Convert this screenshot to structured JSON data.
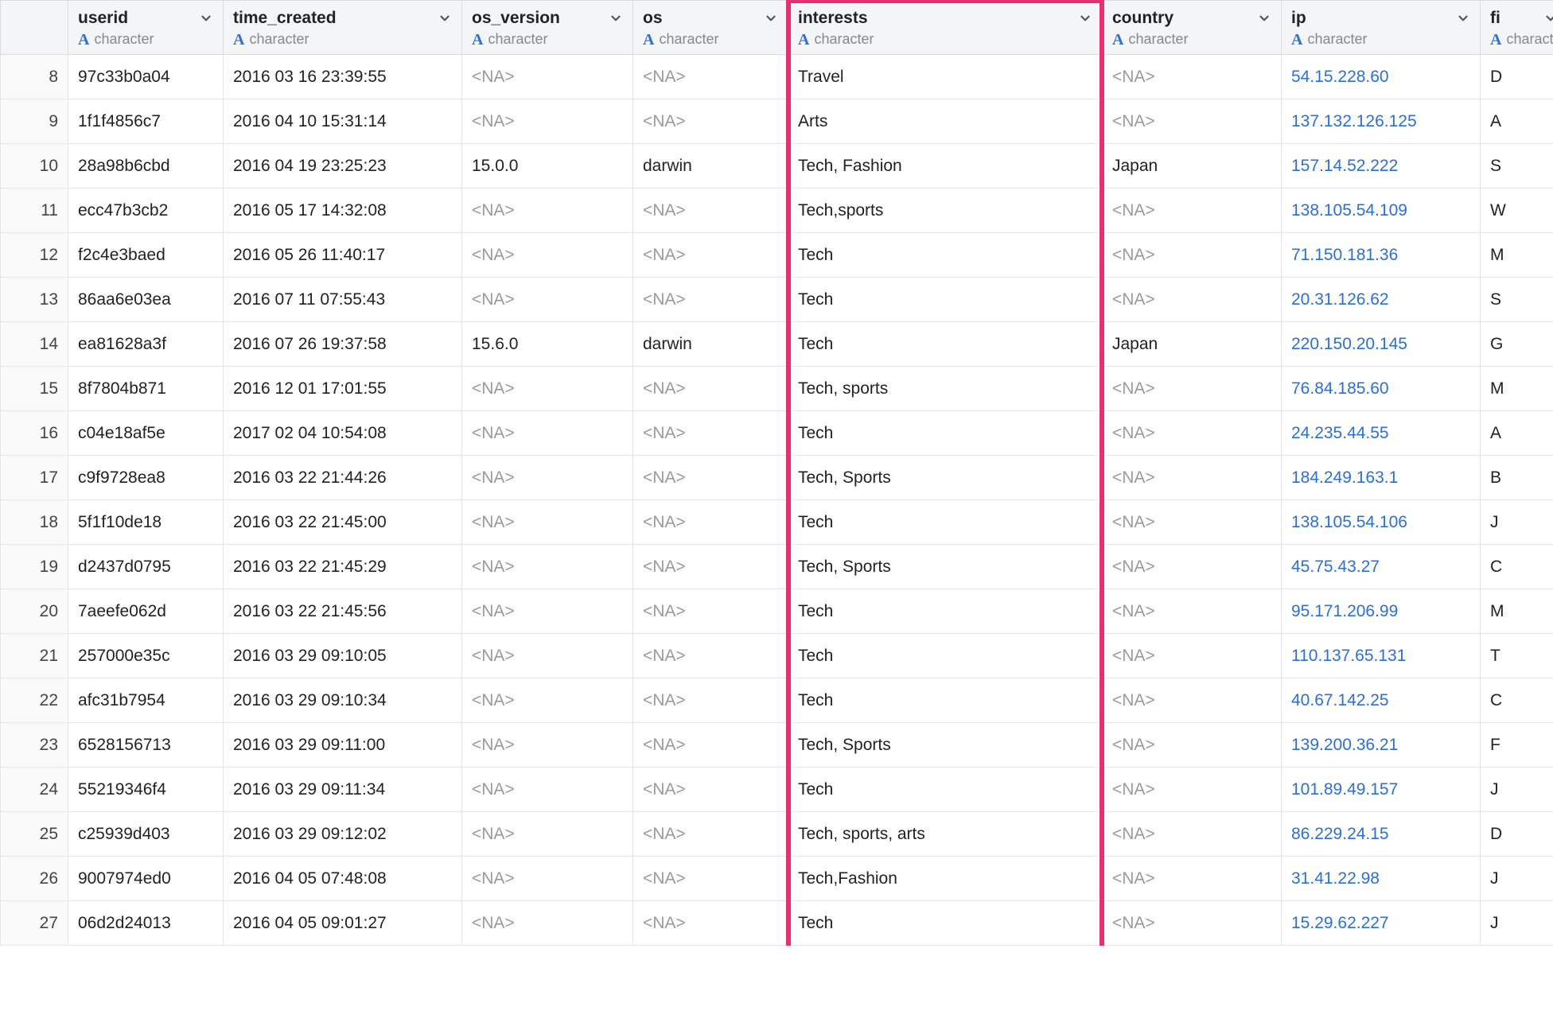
{
  "columns": [
    {
      "key": "userid",
      "label": "userid",
      "type": "character"
    },
    {
      "key": "time_created",
      "label": "time_created",
      "type": "character"
    },
    {
      "key": "os_version",
      "label": "os_version",
      "type": "character"
    },
    {
      "key": "os",
      "label": "os",
      "type": "character"
    },
    {
      "key": "interests",
      "label": "interests",
      "type": "character"
    },
    {
      "key": "country",
      "label": "country",
      "type": "character"
    },
    {
      "key": "ip",
      "label": "ip",
      "type": "character"
    },
    {
      "key": "fi",
      "label": "fi",
      "type": "character"
    }
  ],
  "na_label": "<NA>",
  "highlight_column": "interests",
  "rows": [
    {
      "n": 8,
      "userid": "97c33b0a04",
      "time_created": "2016 03 16 23:39:55",
      "os_version": null,
      "os": null,
      "interests": "Travel",
      "country": null,
      "ip": "54.15.228.60",
      "fi": "D"
    },
    {
      "n": 9,
      "userid": "1f1f4856c7",
      "time_created": "2016 04 10 15:31:14",
      "os_version": null,
      "os": null,
      "interests": "Arts",
      "country": null,
      "ip": "137.132.126.125",
      "fi": "A"
    },
    {
      "n": 10,
      "userid": "28a98b6cbd",
      "time_created": "2016 04 19 23:25:23",
      "os_version": "15.0.0",
      "os": "darwin",
      "interests": "Tech, Fashion",
      "country": "Japan",
      "ip": "157.14.52.222",
      "fi": "S"
    },
    {
      "n": 11,
      "userid": "ecc47b3cb2",
      "time_created": "2016 05 17 14:32:08",
      "os_version": null,
      "os": null,
      "interests": "Tech,sports",
      "country": null,
      "ip": "138.105.54.109",
      "fi": "W"
    },
    {
      "n": 12,
      "userid": "f2c4e3baed",
      "time_created": "2016 05 26 11:40:17",
      "os_version": null,
      "os": null,
      "interests": "Tech",
      "country": null,
      "ip": "71.150.181.36",
      "fi": "M"
    },
    {
      "n": 13,
      "userid": "86aa6e03ea",
      "time_created": "2016 07 11 07:55:43",
      "os_version": null,
      "os": null,
      "interests": "Tech",
      "country": null,
      "ip": "20.31.126.62",
      "fi": "S"
    },
    {
      "n": 14,
      "userid": "ea81628a3f",
      "time_created": "2016 07 26 19:37:58",
      "os_version": "15.6.0",
      "os": "darwin",
      "interests": "Tech",
      "country": "Japan",
      "ip": "220.150.20.145",
      "fi": "G"
    },
    {
      "n": 15,
      "userid": "8f7804b871",
      "time_created": "2016 12 01 17:01:55",
      "os_version": null,
      "os": null,
      "interests": "Tech, sports",
      "country": null,
      "ip": "76.84.185.60",
      "fi": "M"
    },
    {
      "n": 16,
      "userid": "c04e18af5e",
      "time_created": "2017 02 04 10:54:08",
      "os_version": null,
      "os": null,
      "interests": "Tech",
      "country": null,
      "ip": "24.235.44.55",
      "fi": "A"
    },
    {
      "n": 17,
      "userid": "c9f9728ea8",
      "time_created": "2016 03 22 21:44:26",
      "os_version": null,
      "os": null,
      "interests": "Tech, Sports",
      "country": null,
      "ip": "184.249.163.1",
      "fi": "B"
    },
    {
      "n": 18,
      "userid": "5f1f10de18",
      "time_created": "2016 03 22 21:45:00",
      "os_version": null,
      "os": null,
      "interests": "Tech",
      "country": null,
      "ip": "138.105.54.106",
      "fi": "J"
    },
    {
      "n": 19,
      "userid": "d2437d0795",
      "time_created": "2016 03 22 21:45:29",
      "os_version": null,
      "os": null,
      "interests": "Tech, Sports",
      "country": null,
      "ip": "45.75.43.27",
      "fi": "C"
    },
    {
      "n": 20,
      "userid": "7aeefe062d",
      "time_created": "2016 03 22 21:45:56",
      "os_version": null,
      "os": null,
      "interests": "Tech",
      "country": null,
      "ip": "95.171.206.99",
      "fi": "M"
    },
    {
      "n": 21,
      "userid": "257000e35c",
      "time_created": "2016 03 29 09:10:05",
      "os_version": null,
      "os": null,
      "interests": "Tech",
      "country": null,
      "ip": "110.137.65.131",
      "fi": "T"
    },
    {
      "n": 22,
      "userid": "afc31b7954",
      "time_created": "2016 03 29 09:10:34",
      "os_version": null,
      "os": null,
      "interests": "Tech",
      "country": null,
      "ip": "40.67.142.25",
      "fi": "C"
    },
    {
      "n": 23,
      "userid": "6528156713",
      "time_created": "2016 03 29 09:11:00",
      "os_version": null,
      "os": null,
      "interests": "Tech, Sports",
      "country": null,
      "ip": "139.200.36.21",
      "fi": "F"
    },
    {
      "n": 24,
      "userid": "55219346f4",
      "time_created": "2016 03 29 09:11:34",
      "os_version": null,
      "os": null,
      "interests": "Tech",
      "country": null,
      "ip": "101.89.49.157",
      "fi": "J"
    },
    {
      "n": 25,
      "userid": "c25939d403",
      "time_created": "2016 03 29 09:12:02",
      "os_version": null,
      "os": null,
      "interests": "Tech, sports, arts",
      "country": null,
      "ip": "86.229.24.15",
      "fi": "D"
    },
    {
      "n": 26,
      "userid": "9007974ed0",
      "time_created": "2016 04 05 07:48:08",
      "os_version": null,
      "os": null,
      "interests": "Tech,Fashion",
      "country": null,
      "ip": "31.41.22.98",
      "fi": "J"
    },
    {
      "n": 27,
      "userid": "06d2d24013",
      "time_created": "2016 04 05 09:01:27",
      "os_version": null,
      "os": null,
      "interests": "Tech",
      "country": null,
      "ip": "15.29.62.227",
      "fi": "J"
    }
  ]
}
